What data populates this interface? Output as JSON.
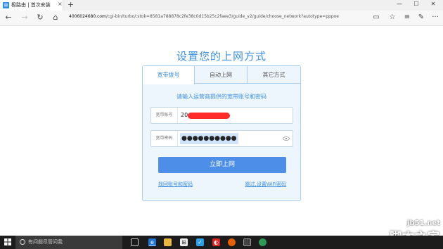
{
  "browser": {
    "tab_title": "极路由 | 首次安装",
    "tab_favicon": "favicon-icon",
    "url_host": "4006024680.com",
    "url_path": "/cgi-bin/turbo/;stok=8581a788878c2fe38c0d15b25c2faee3/guide_v2/guide/choose_network?autotype=pppoe",
    "buttons": {
      "back": "←",
      "forward": "→",
      "reload": "↻",
      "home": "⌂",
      "newtab": "+",
      "close_tab": "×",
      "reading": "▭",
      "star": "☆",
      "hub": "≡",
      "note": "✎",
      "more": "···",
      "minimize": "—",
      "maximize": "☐",
      "close": "✕"
    }
  },
  "page": {
    "title": "设置您的上网方式",
    "tabs": [
      {
        "label": "宽带拨号",
        "active": true
      },
      {
        "label": "自动上网",
        "active": false
      },
      {
        "label": "其它方式",
        "active": false
      }
    ],
    "hint": "请输入运营商提供的宽带账号和密码",
    "account": {
      "label": "宽带账号",
      "value": "20"
    },
    "password": {
      "label": "宽带密码",
      "value": "●●●●●●●●●●"
    },
    "submit_label": "立即上网",
    "link_left": "找回账号和密码",
    "link_right": "跳过,设置WiFi密码"
  },
  "taskbar": {
    "start_icon": "windows-logo-icon",
    "search_placeholder": "有问题尽管问我",
    "apps": [
      "task-view-icon",
      "edge-icon",
      "explorer-icon",
      "store-icon",
      "app-icon",
      "netease-icon",
      "firefox-icon",
      "media-icon",
      "weather-icon"
    ]
  },
  "watermark": {
    "site": "jb51.net",
    "name": "脚本之家"
  },
  "colors": {
    "accent": "#3c8fe0",
    "button": "#4d8fe8",
    "panel_bg": "#eef6fd",
    "panel_border": "#a9cdee",
    "taskbar": "#1c1c1c"
  }
}
